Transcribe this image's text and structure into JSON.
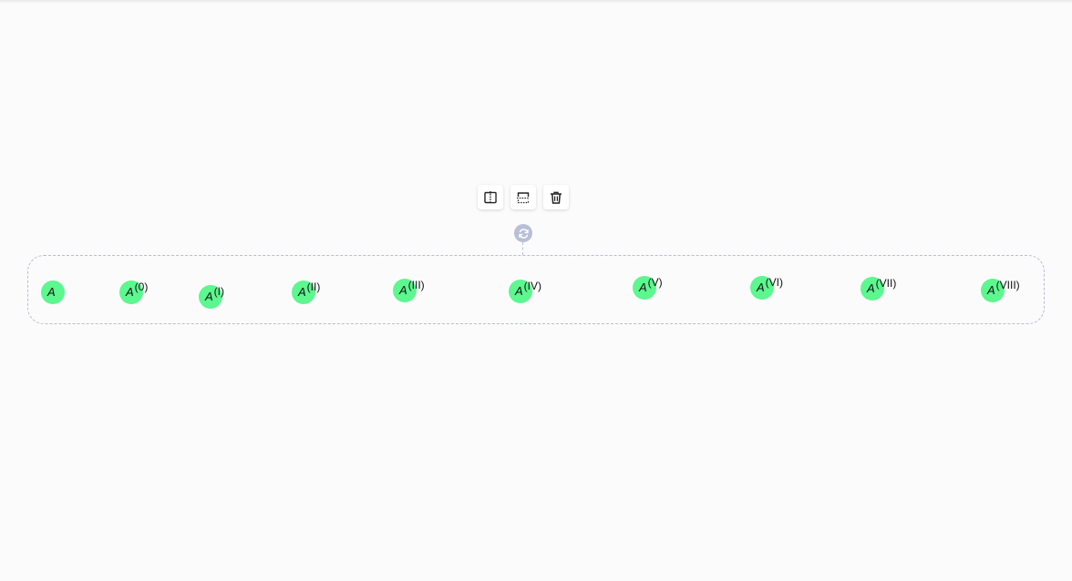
{
  "toolbar": {
    "buttons": [
      {
        "name": "split-vertical-button",
        "icon": "split-vertical-icon"
      },
      {
        "name": "split-horizontal-button",
        "icon": "split-horizontal-icon"
      },
      {
        "name": "delete-button",
        "icon": "trash-icon"
      }
    ]
  },
  "rotate_handle": {
    "icon": "rotate-icon"
  },
  "colors": {
    "node_fill": "#5cf78f",
    "selection_border": "#b8bccf",
    "handle": "#b9bfd6",
    "background": "#fbfbfc"
  },
  "nodes": [
    {
      "base": "A",
      "sup": ""
    },
    {
      "base": "A",
      "sup": "(0)"
    },
    {
      "base": "A",
      "sup": "(I)"
    },
    {
      "base": "A",
      "sup": "(II)"
    },
    {
      "base": "A",
      "sup": "(III)"
    },
    {
      "base": "A",
      "sup": "(IV)"
    },
    {
      "base": "A",
      "sup": "(V)"
    },
    {
      "base": "A",
      "sup": "(VI)"
    },
    {
      "base": "A",
      "sup": "(VII)"
    },
    {
      "base": "A",
      "sup": "(VIII)"
    }
  ]
}
